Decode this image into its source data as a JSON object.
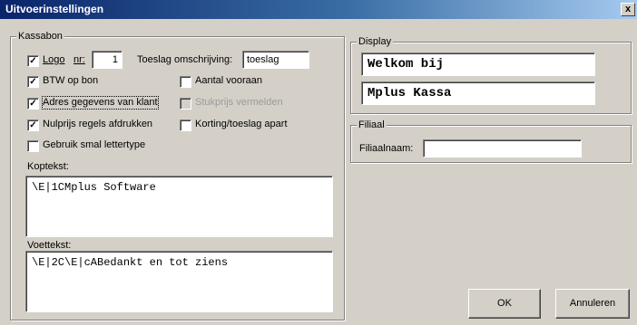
{
  "window": {
    "title": "Uitvoerinstellingen",
    "close_glyph": "x"
  },
  "kassabon": {
    "legend": "Kassabon",
    "logo": {
      "label": "Logo",
      "checked": true
    },
    "nr_label": "nr:",
    "nr_value": "1",
    "toeslag_omschrijving_label": "Toeslag omschrijving:",
    "toeslag_omschrijving_value": "toeslag",
    "btw_op_bon": {
      "label": "BTW op bon",
      "checked": true
    },
    "aantal_vooraan": {
      "label": "Aantal vooraan",
      "checked": false
    },
    "adres_gegevens": {
      "label": "Adres gegevens van klant",
      "checked": true
    },
    "stukprijs_vermelden": {
      "label": "Stukprijs vermelden",
      "checked": false,
      "disabled": true
    },
    "nulprijs_regels": {
      "label": "Nulprijs regels afdrukken",
      "checked": true
    },
    "korting_toeslag_apart": {
      "label": "Korting/toeslag apart",
      "checked": false
    },
    "smal_lettertype": {
      "label": "Gebruik smal lettertype",
      "checked": false
    },
    "kopteskst_label": "Koptekst:",
    "koptekst_value": "\\E|1CMplus Software",
    "voettekst_label": "Voettekst:",
    "voettekst_value": "\\E|2C\\E|cABedankt en tot ziens"
  },
  "display": {
    "legend": "Display",
    "line1": "Welkom bij",
    "line2": "Mplus Kassa"
  },
  "filiaal": {
    "legend": "Filiaal",
    "naam_label": "Filiaalnaam:",
    "naam_value": ""
  },
  "buttons": {
    "ok": "OK",
    "annuleren": "Annuleren"
  },
  "check_glyph": "✓"
}
